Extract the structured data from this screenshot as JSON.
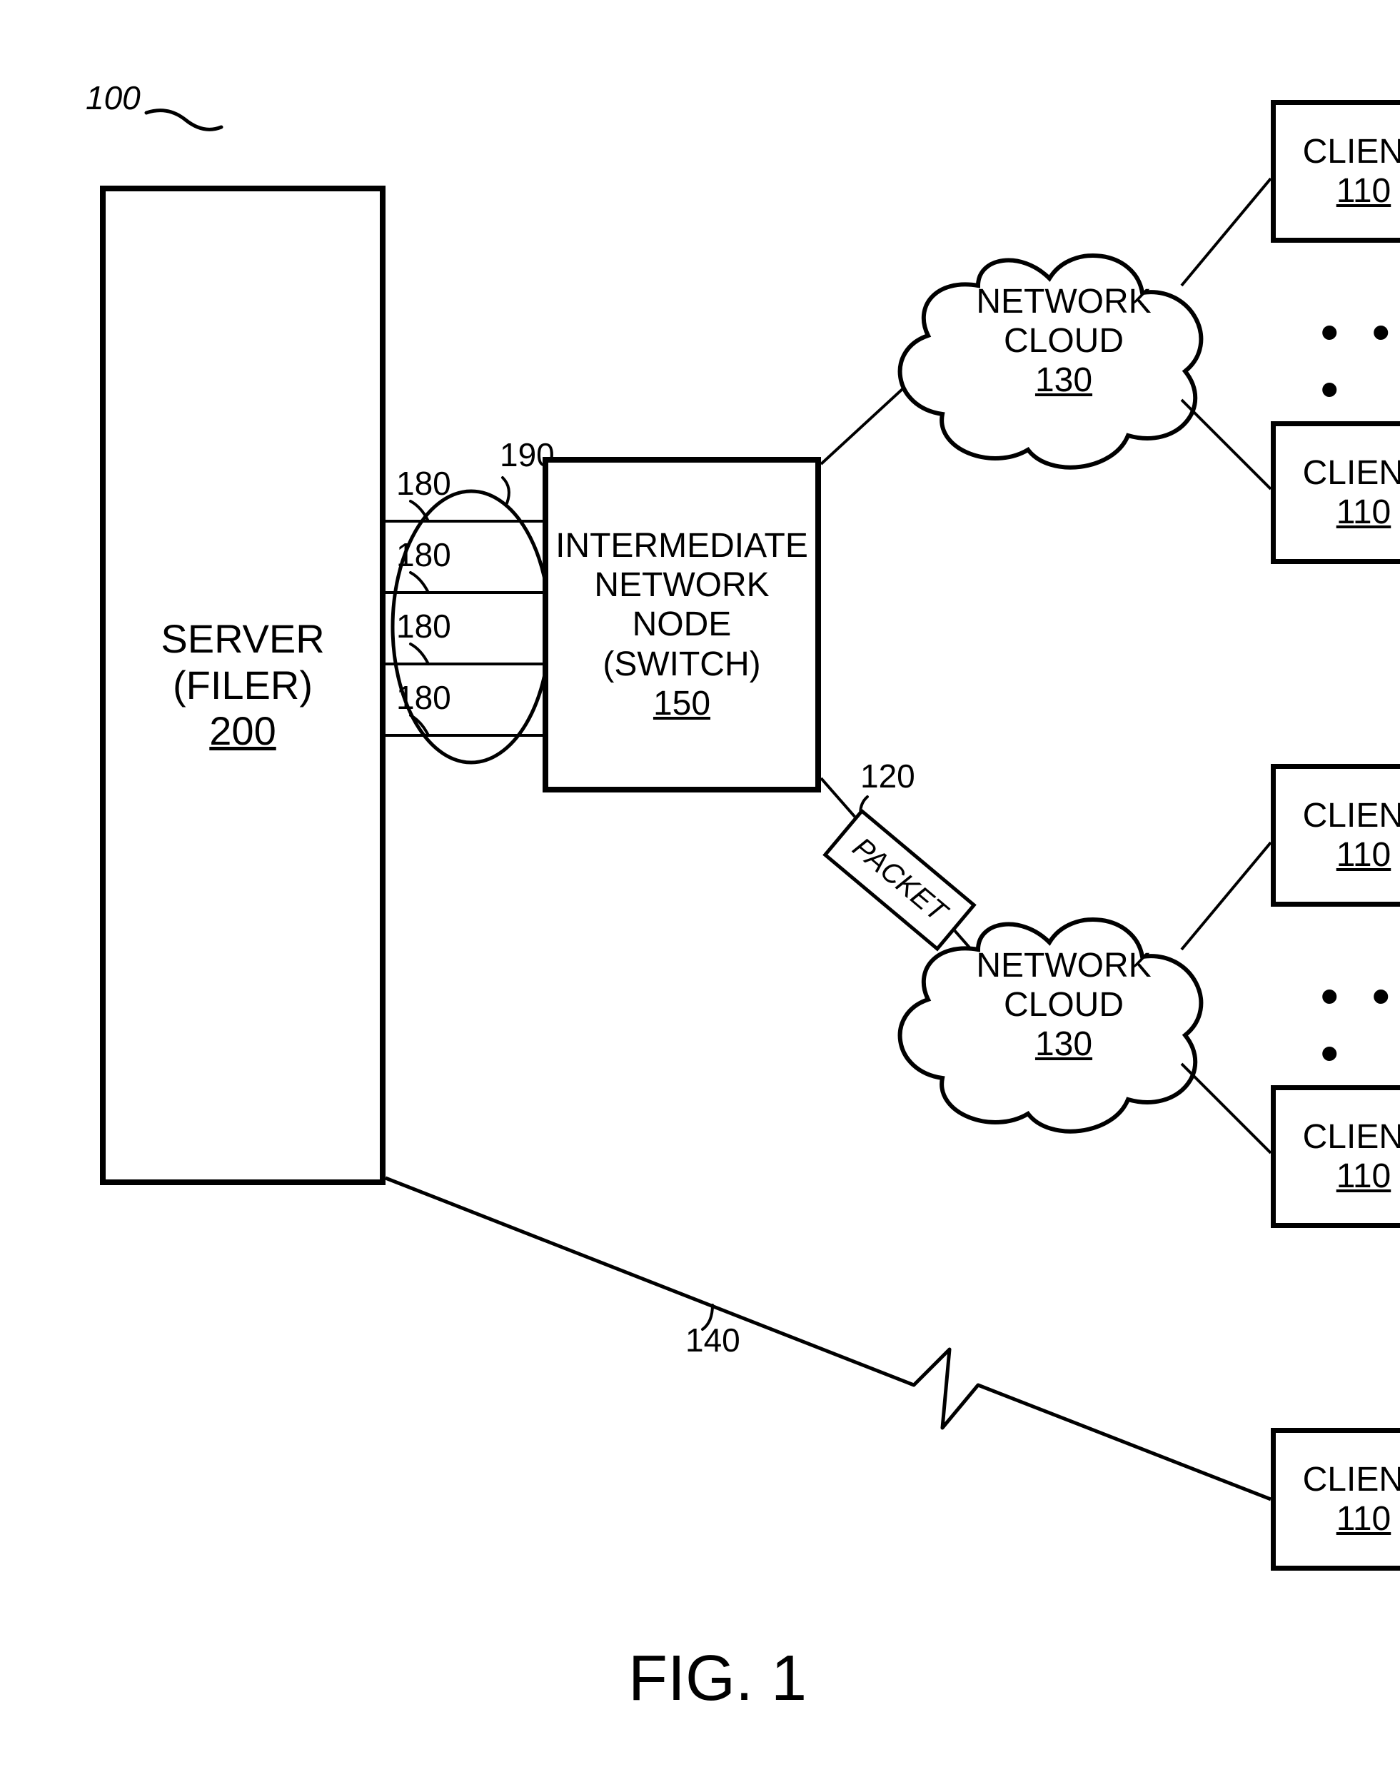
{
  "figure_label": "FIG. 1",
  "ref_system": "100",
  "server": {
    "label_l1": "SERVER",
    "label_l2": "(FILER)",
    "label_l3": "200"
  },
  "switch": {
    "label_l1": "INTERMEDIATE",
    "label_l2": "NETWORK",
    "label_l3": "NODE",
    "label_l4": "(SWITCH)",
    "label_l5": "150"
  },
  "cloud": {
    "label_l1": "NETWORK",
    "label_l2": "CLOUD",
    "label_l3": "130"
  },
  "client": {
    "label": "CLIENT",
    "ref": "110"
  },
  "packet": {
    "label": "PACKET",
    "ref": "120"
  },
  "trunk": {
    "ref": "190"
  },
  "link": {
    "ref": "180"
  },
  "direct_link": {
    "ref": "140"
  },
  "ellipsis": "• • •"
}
